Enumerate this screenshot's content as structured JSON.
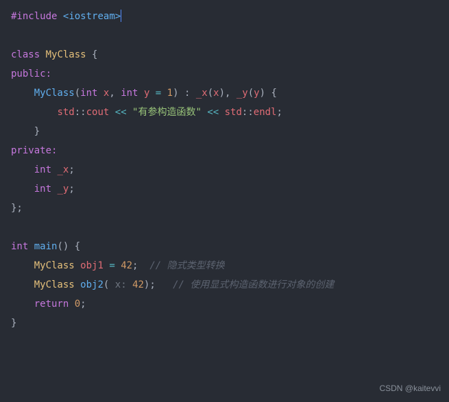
{
  "code": {
    "line1": {
      "include": "#include",
      "lt": "<",
      "header": "iostream",
      "gt": ">"
    },
    "line3": {
      "class_kw": "class",
      "class_name": "MyClass",
      "brace": " {"
    },
    "line4": {
      "access": "public:"
    },
    "line5": {
      "ctor": "MyClass",
      "int1": "int",
      "x": "x",
      "comma": ", ",
      "int2": "int",
      "y": "y",
      "eq": " = ",
      "one": "1",
      "colon_init": " : ",
      "mx": "_x",
      "px": "x",
      "my": "_y",
      "py": "y",
      "brace": " {"
    },
    "line6": {
      "std1": "std",
      "scope1": "::",
      "cout": "cout",
      "lshift1": " << ",
      "str": "\"有参构造函数\"",
      "lshift2": " << ",
      "std2": "std",
      "scope2": "::",
      "endl": "endl",
      "semi": ";"
    },
    "line7": {
      "brace": "}"
    },
    "line8": {
      "access": "private:"
    },
    "line9": {
      "int": "int",
      "mx": "_x",
      "semi": ";"
    },
    "line10": {
      "int": "int",
      "my": "_y",
      "semi": ";"
    },
    "line11": {
      "close": "};"
    },
    "line13": {
      "int": "int",
      "main": "main",
      "parens": "()",
      "brace": " {"
    },
    "line14": {
      "cls": "MyClass",
      "obj": "obj1",
      "eq": " = ",
      "num": "42",
      "semi": ";",
      "comment": "// 隐式类型转换"
    },
    "line15": {
      "cls": "MyClass",
      "obj": "obj2",
      "hint": "x:",
      "num": "42",
      "semi": ";",
      "comment": "// 使用显式构造函数进行对象的创建"
    },
    "line16": {
      "return": "return",
      "zero": "0",
      "semi": ";"
    },
    "line17": {
      "brace": "}"
    }
  },
  "watermark": "CSDN @kaitevvi"
}
